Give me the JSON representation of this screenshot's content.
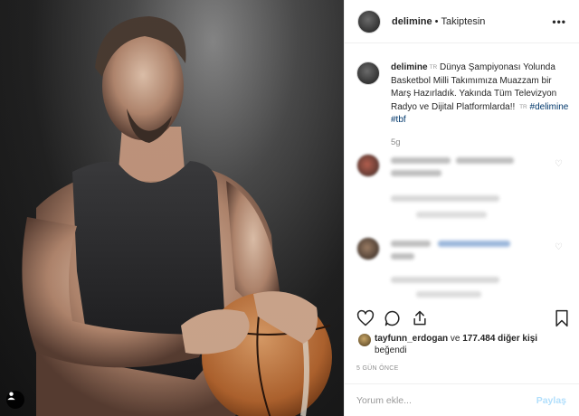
{
  "post": {
    "username": "delimine",
    "separator": "•",
    "follow_status": "Takiptesin",
    "more_icon": "ellipsis-icon",
    "caption": {
      "username": "delimine",
      "lang_badge": "TR",
      "text": "Dünya Şampiyonası Yolunda Basketbol Milli Takımımıza Muazzam bir Marş Hazırladık. Yakında Tüm Televizyon Radyo ve Dijital Platformlarda!!",
      "lang_badge_2": "TR",
      "hashtags": [
        "#delimine",
        "#tbf"
      ]
    },
    "caption_age": "5g",
    "likes": {
      "first_user": "tayfunn_erdogan",
      "connector": "ve",
      "others": "177.484 diğer kişi",
      "suffix": "beğendi"
    },
    "posted_ago": "5 GÜN ÖNCE",
    "comment": {
      "placeholder": "Yorum ekle...",
      "post_label": "Paylaş"
    },
    "colors": {
      "hashtag": "#00376b",
      "post_button": "#b2dffc",
      "muted": "#8e8e8e"
    }
  }
}
